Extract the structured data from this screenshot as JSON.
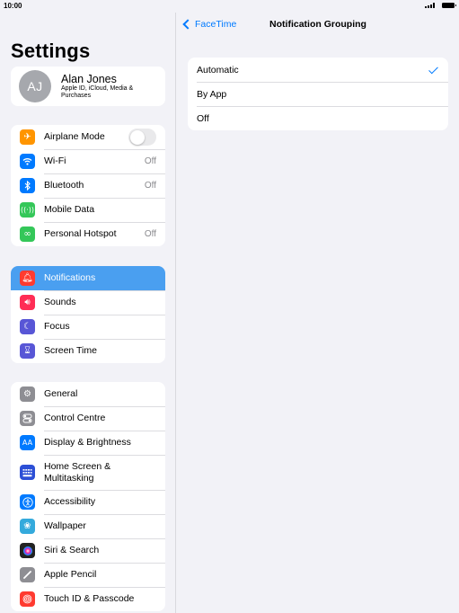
{
  "status": {
    "time": "10:00"
  },
  "sidebar": {
    "title": "Settings",
    "profile": {
      "initials": "AJ",
      "name": "Alan Jones",
      "subtitle": "Apple ID, iCloud, Media & Purchases"
    },
    "group1": [
      {
        "label": "Airplane Mode",
        "icon": "airplane-icon",
        "color": "#ff9500",
        "toggle": false
      },
      {
        "label": "Wi-Fi",
        "icon": "wifi-icon",
        "color": "#007aff",
        "value": "Off"
      },
      {
        "label": "Bluetooth",
        "icon": "bluetooth-icon",
        "color": "#007aff",
        "value": "Off"
      },
      {
        "label": "Mobile Data",
        "icon": "antenna-icon",
        "color": "#34c759"
      },
      {
        "label": "Personal Hotspot",
        "icon": "hotspot-icon",
        "color": "#34c759",
        "value": "Off"
      }
    ],
    "group2": [
      {
        "label": "Notifications",
        "icon": "bell-icon",
        "color": "#ff3b30",
        "selected": true
      },
      {
        "label": "Sounds",
        "icon": "speaker-icon",
        "color": "#ff2d55"
      },
      {
        "label": "Focus",
        "icon": "moon-icon",
        "color": "#5856d6"
      },
      {
        "label": "Screen Time",
        "icon": "hourglass-icon",
        "color": "#5856d6"
      }
    ],
    "group3": [
      {
        "label": "General",
        "icon": "gear-icon",
        "color": "#8e8e93"
      },
      {
        "label": "Control Centre",
        "icon": "switches-icon",
        "color": "#8e8e93"
      },
      {
        "label": "Display & Brightness",
        "icon": "text-size-icon",
        "color": "#007aff"
      },
      {
        "label": "Home Screen & Multitasking",
        "icon": "home-grid-icon",
        "color": "#2c4fd6"
      },
      {
        "label": "Accessibility",
        "icon": "accessibility-icon",
        "color": "#007aff"
      },
      {
        "label": "Wallpaper",
        "icon": "flower-icon",
        "color": "#34aadc"
      },
      {
        "label": "Siri & Search",
        "icon": "siri-icon",
        "color": "#222222"
      },
      {
        "label": "Apple Pencil",
        "icon": "pencil-icon",
        "color": "#8e8e93"
      },
      {
        "label": "Touch ID & Passcode",
        "icon": "fingerprint-icon",
        "color": "#ff3b30"
      }
    ]
  },
  "detail": {
    "back_label": "FaceTime",
    "title": "Notification Grouping",
    "options": [
      {
        "label": "Automatic",
        "checked": true
      },
      {
        "label": "By App",
        "checked": false
      },
      {
        "label": "Off",
        "checked": false
      }
    ]
  }
}
